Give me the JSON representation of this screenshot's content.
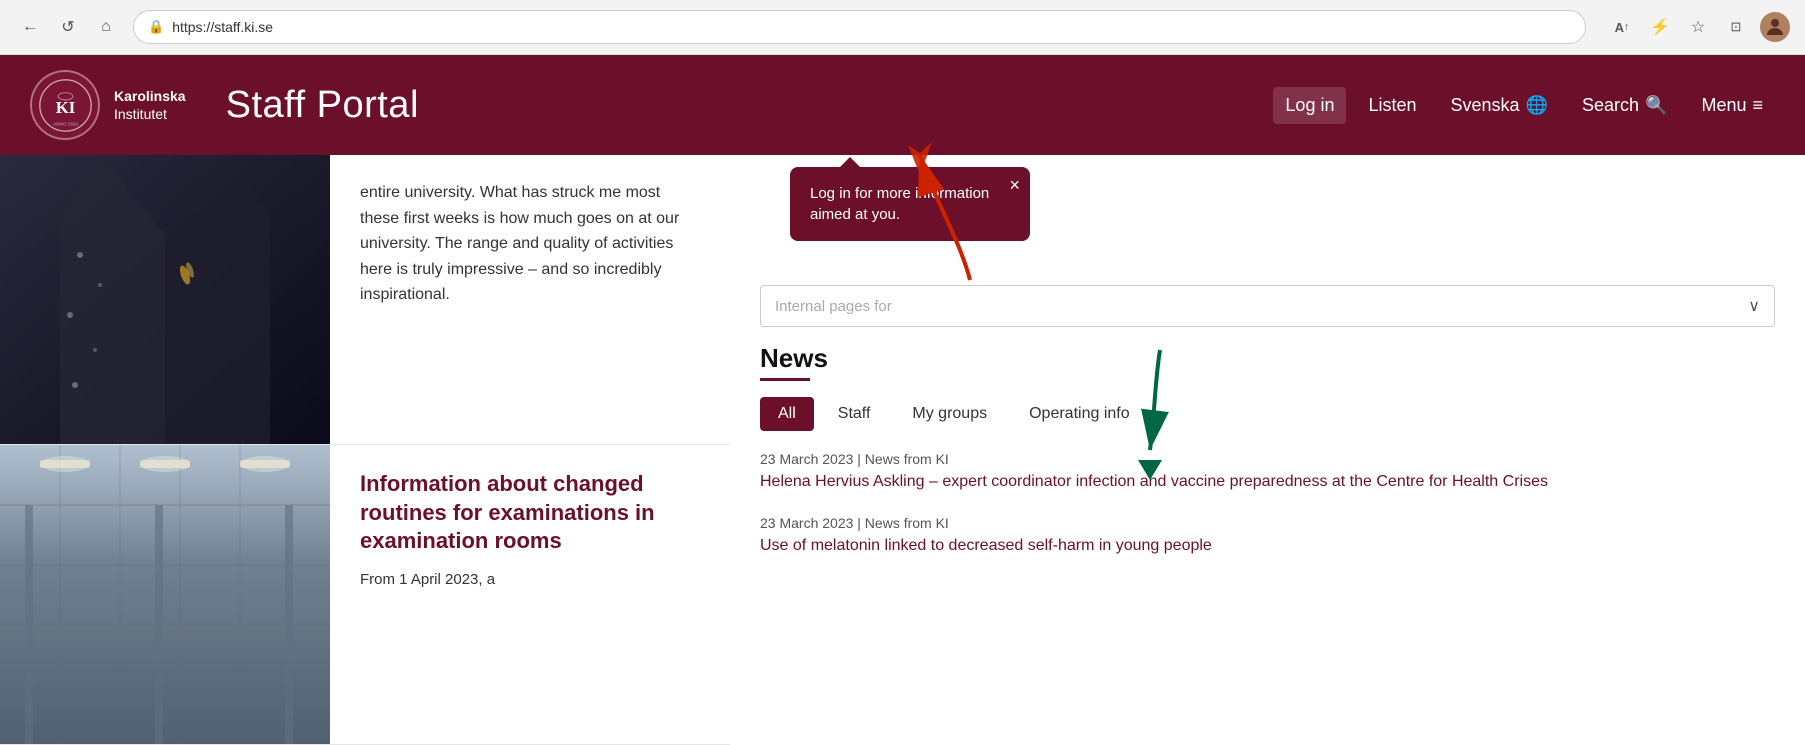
{
  "browser": {
    "url": "https://staff.ki.se",
    "back_btn": "←",
    "refresh_btn": "↺",
    "home_btn": "⌂"
  },
  "header": {
    "site_title": "Staff Portal",
    "logo_alt": "Karolinska Institutet Logo",
    "nav": {
      "login": "Log in",
      "listen": "Listen",
      "svenska": "Svenska",
      "search": "Search",
      "menu": "Menu"
    }
  },
  "article1": {
    "body_text": "entire university. What has struck me most these first weeks is how much goes on at our university. The range and quality of activities here is truly impressive – and so incredibly inspirational."
  },
  "article2": {
    "title": "Information about changed routines for examinations in examination rooms",
    "intro": "From 1 April 2023, a"
  },
  "right_panel": {
    "filter_placeholder": "",
    "internal_pages_placeholder": "Internal pages for",
    "news_title": "News",
    "tabs": [
      {
        "label": "All",
        "active": true
      },
      {
        "label": "Staff",
        "active": false
      },
      {
        "label": "My groups",
        "active": false
      },
      {
        "label": "Operating info",
        "active": false
      }
    ],
    "news_items": [
      {
        "meta": "23 March 2023 | News from KI",
        "link_text": "Helena Hervius Askling – expert coordinator infection and vaccine preparedness at the Centre for Health Crises"
      },
      {
        "meta": "23 March 2023 | News from KI",
        "link_text": "Use of melatonin linked to decreased self-harm in young people"
      }
    ]
  },
  "tooltip": {
    "text": "Log in for more information aimed at you.",
    "close_label": "×"
  },
  "colors": {
    "brand": "#6b0f2b",
    "link": "#6b0f2b"
  }
}
